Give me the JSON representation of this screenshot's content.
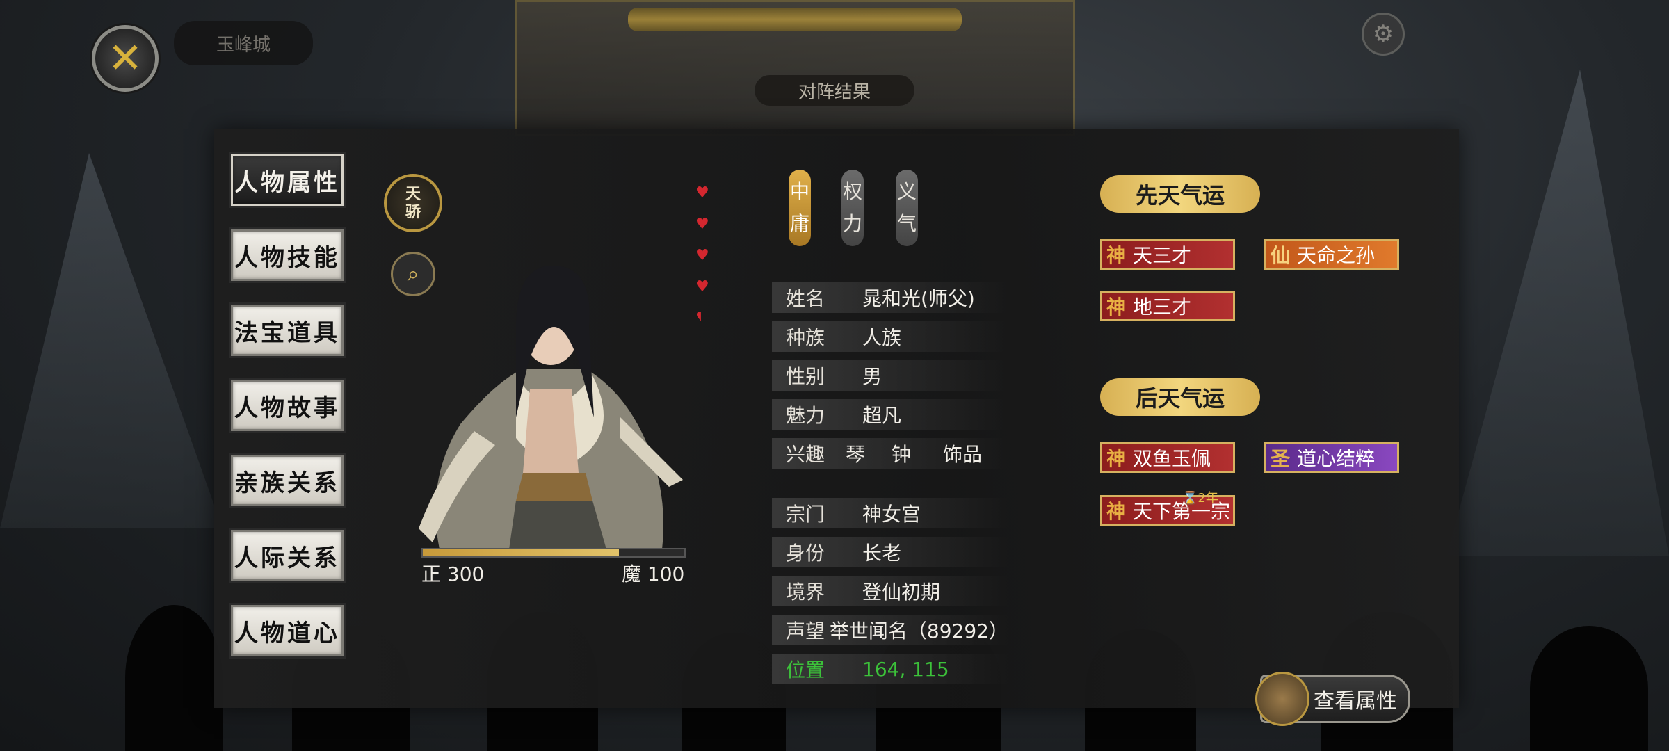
{
  "background": {
    "city_label": "玉峰城",
    "result_title": "对阵结果"
  },
  "menu": {
    "items": [
      {
        "label": "人物属性",
        "active": true
      },
      {
        "label": "人物技能",
        "active": false
      },
      {
        "label": "法宝道具",
        "active": false
      },
      {
        "label": "人物故事",
        "active": false
      },
      {
        "label": "亲族关系",
        "active": false
      },
      {
        "label": "人际关系",
        "active": false
      },
      {
        "label": "人物道心",
        "active": false
      }
    ]
  },
  "badge": {
    "label": "天骄"
  },
  "icons": {
    "close": "close-icon",
    "search": "magnifier-icon",
    "heart": "heart-icon",
    "settings": "gear-icon"
  },
  "alignment": {
    "left_label": "正 300",
    "right_label": "魔 100",
    "fill_fraction": 0.75
  },
  "hearts": {
    "full": 4,
    "partial": 1
  },
  "traits": [
    {
      "chars": [
        "中",
        "庸"
      ],
      "style": "gold"
    },
    {
      "chars": [
        "权",
        "力"
      ],
      "style": "grey"
    },
    {
      "chars": [
        "义",
        "气"
      ],
      "style": "grey"
    }
  ],
  "info": {
    "name": {
      "label": "姓名",
      "value": "晁和光(师父)"
    },
    "race": {
      "label": "种族",
      "value": "人族"
    },
    "gender": {
      "label": "性别",
      "value": "男"
    },
    "charm": {
      "label": "魅力",
      "value": "超凡"
    },
    "hobby": {
      "label": "兴趣",
      "items": [
        "琴",
        "钟",
        "饰品"
      ]
    },
    "sect": {
      "label": "宗门",
      "value": "神女宫"
    },
    "identity": {
      "label": "身份",
      "value": "长老"
    },
    "realm": {
      "label": "境界",
      "value": "登仙初期"
    },
    "reputation": {
      "label": "声望",
      "value": "举世闻名（89292）"
    },
    "position": {
      "label": "位置",
      "value": "164, 115"
    }
  },
  "innate_fortune": {
    "title": "先天气运",
    "tags": [
      {
        "icon": "神",
        "label": "天三才",
        "color": "red"
      },
      {
        "icon": "仙",
        "label": "天命之孙",
        "color": "orange"
      },
      {
        "icon": "神",
        "label": "地三才",
        "color": "red"
      }
    ]
  },
  "acquired_fortune": {
    "title": "后天气运",
    "tags": [
      {
        "icon": "神",
        "label": "双鱼玉佩",
        "color": "red"
      },
      {
        "icon": "圣",
        "label": "道心结粹",
        "color": "purple"
      },
      {
        "icon": "神",
        "label": "天下第一宗",
        "color": "red"
      }
    ],
    "duration": "2年"
  },
  "view_attributes": {
    "label": "查看属性"
  }
}
